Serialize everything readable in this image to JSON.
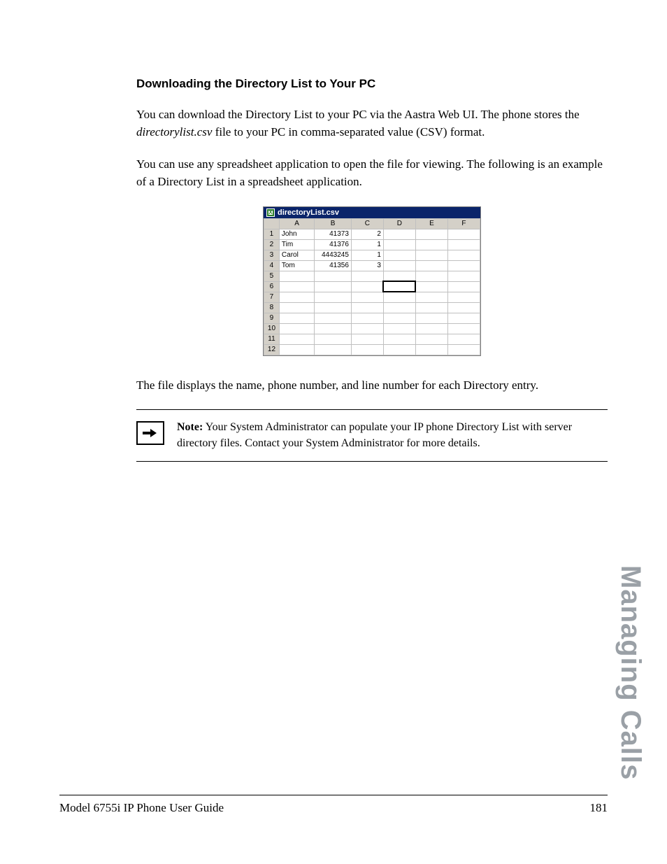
{
  "heading": "Downloading the Directory List to Your PC",
  "para1a": "You can download the Directory List to your PC via the Aastra Web UI. The phone stores the ",
  "para1b_italic": "directorylist.csv",
  "para1c": " file to your PC in comma-separated value (CSV) format.",
  "para2": "You can use any spreadsheet application to open the file for viewing. The following is an example of a Directory List in a spreadsheet application.",
  "spreadsheet": {
    "filename": "directoryList.csv",
    "columns": [
      "A",
      "B",
      "C",
      "D",
      "E",
      "F"
    ],
    "row_numbers": [
      "1",
      "2",
      "3",
      "4",
      "5",
      "6",
      "7",
      "8",
      "9",
      "10",
      "11",
      "12"
    ],
    "rows": [
      {
        "a": "John",
        "b": "41373",
        "c": "2"
      },
      {
        "a": "Tim",
        "b": "41376",
        "c": "1"
      },
      {
        "a": "Carol",
        "b": "4443245",
        "c": "1"
      },
      {
        "a": "Tom",
        "b": "41356",
        "c": "3"
      }
    ],
    "selected_cell": "D6"
  },
  "para3": "The file displays the name, phone number, and line number for each Directory entry.",
  "note": {
    "label": "Note:",
    "text": "  Your System Administrator can populate your IP phone Directory List with server directory files. Contact your System Administrator for more details."
  },
  "footer": {
    "left": "Model 6755i IP Phone User Guide",
    "right": "181"
  },
  "side_tab": "Managing Calls"
}
